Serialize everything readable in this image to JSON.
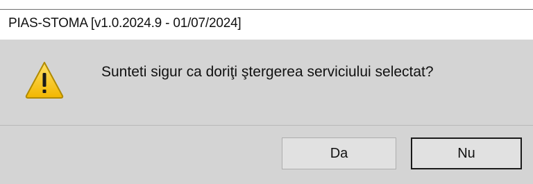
{
  "window": {
    "title": "PIAS-STOMA [v1.0.2024.9 - 01/07/2024]"
  },
  "dialog": {
    "icon": "warning-icon",
    "message": "Sunteti sigur ca doriţi ştergerea serviciului selectat?",
    "buttons": {
      "yes_label": "Da",
      "no_label": "Nu"
    }
  },
  "colors": {
    "dialog_background": "#d4d4d4",
    "warning_yellow": "#f5c400",
    "warning_outline": "#b08a00",
    "default_button_border": "#1a1a1a"
  }
}
